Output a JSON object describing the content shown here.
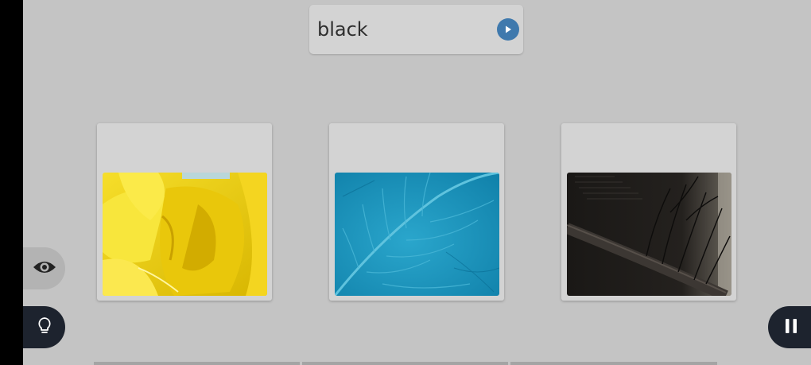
{
  "prompt": {
    "word": "black",
    "play_icon": "play-icon"
  },
  "choices": [
    {
      "image": "yellow-flower-petals",
      "color": "#f2d70e"
    },
    {
      "image": "blue-feather",
      "color": "#1796bd"
    },
    {
      "image": "black-feather",
      "color": "#1e1b18"
    }
  ],
  "controls": {
    "reveal_icon": "eye-icon",
    "hint_icon": "lightbulb-icon",
    "pause_icon": "pause-icon"
  },
  "colors": {
    "background": "#c4c4c4",
    "card": "#d3d3d3",
    "accent": "#3f79ad",
    "dark_button": "#1d232e"
  }
}
